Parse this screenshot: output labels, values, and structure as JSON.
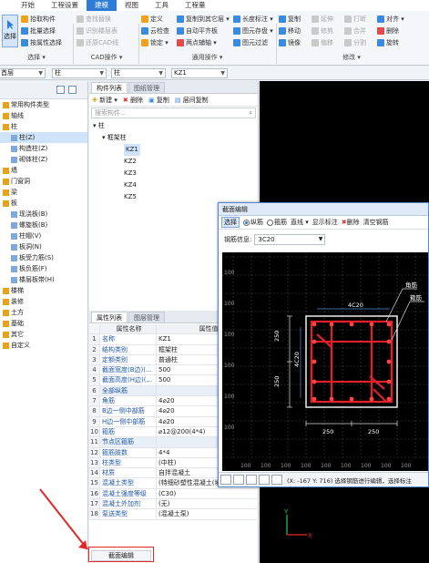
{
  "menubar": {
    "tabs": [
      "开始",
      "工程设置",
      "建模",
      "视图",
      "工具",
      "工程量"
    ],
    "active": 2
  },
  "ribbon": {
    "select_btn": "选择",
    "select_group": {
      "items": [
        "拾取构件",
        "批量选择",
        "按属性选择"
      ],
      "label": "选择 ▾"
    },
    "cad_group": {
      "items": [
        "查找替换",
        "识别楼层表",
        "还原CAD线"
      ],
      "label": "CAD操作 ▾"
    },
    "common_group": {
      "col1": [
        "定义",
        "云检查",
        "锁定 ▾"
      ],
      "col2": [
        "复制到其它层 ▾",
        "自动平齐板",
        "两点辅轴 ▾"
      ],
      "col3": [
        "长度标注 ▾",
        "图元存盘 ▾",
        "图元过滤"
      ],
      "label": "通用操作 ▾"
    },
    "modify_group": {
      "col1": [
        "复制",
        "移动",
        "镜像"
      ],
      "col2": [
        "延伸",
        "修剪",
        "偏移"
      ],
      "col3": [
        "打断",
        "合并",
        "分割"
      ],
      "col4": [
        "对齐 ▾",
        "删除",
        "旋转"
      ],
      "label": "修改 ▾"
    }
  },
  "combos": {
    "floor": "首层",
    "category": "柱",
    "subcategory": "柱",
    "element": "KZ1"
  },
  "left_tree": {
    "items": [
      {
        "label": "常用构件类型",
        "level": 0,
        "sel": false
      },
      {
        "label": "轴线",
        "level": 0
      },
      {
        "label": "柱",
        "level": 0
      },
      {
        "label": "柱(Z)",
        "level": 1,
        "sel": true
      },
      {
        "label": "构造柱(Z)",
        "level": 1
      },
      {
        "label": "砌体柱(Z)",
        "level": 1
      },
      {
        "label": "墙",
        "level": 0
      },
      {
        "label": "门窗洞",
        "level": 0
      },
      {
        "label": "梁",
        "level": 0
      },
      {
        "label": "板",
        "level": 0
      },
      {
        "label": "现浇板(B)",
        "level": 1
      },
      {
        "label": "螺旋板(B)",
        "level": 1
      },
      {
        "label": "柱帽(V)",
        "level": 1
      },
      {
        "label": "板洞(N)",
        "level": 1
      },
      {
        "label": "板受力筋(S)",
        "level": 1
      },
      {
        "label": "板负筋(F)",
        "level": 1
      },
      {
        "label": "楼层板带(H)",
        "level": 1
      },
      {
        "label": "楼梯",
        "level": 0
      },
      {
        "label": "装修",
        "level": 0
      },
      {
        "label": "土方",
        "level": 0
      },
      {
        "label": "基础",
        "level": 0
      },
      {
        "label": "其它",
        "level": 0
      },
      {
        "label": "自定义",
        "level": 0
      }
    ]
  },
  "component_list": {
    "tabs": [
      "构件列表",
      "图纸管理"
    ],
    "toolbar": [
      "新建 ▾",
      "删除",
      "复制",
      "层间复制"
    ],
    "search_placeholder": "搜索构件...",
    "tree": {
      "root": "柱",
      "group": "框架柱",
      "items": [
        "KZ1",
        "KZ2",
        "KZ3",
        "KZ4",
        "KZ5"
      ],
      "selected": "KZ1"
    }
  },
  "properties": {
    "tabs": [
      "属性列表",
      "图层管理"
    ],
    "header": [
      "属性名称",
      "属性值"
    ],
    "rows": [
      {
        "n": "1",
        "name": "名称",
        "value": "KZ1"
      },
      {
        "n": "2",
        "name": "结构类别",
        "value": "框架柱"
      },
      {
        "n": "3",
        "name": "定额类别",
        "value": "普通柱"
      },
      {
        "n": "4",
        "name": "截面宽度(B边)(...",
        "value": "500"
      },
      {
        "n": "5",
        "name": "截面高度(H边)(...",
        "value": "500"
      },
      {
        "n": "6",
        "name": "全部纵筋",
        "value": ""
      },
      {
        "n": "7",
        "name": "角筋",
        "value": "4⌀20"
      },
      {
        "n": "8",
        "name": "B边一侧中部筋",
        "value": "4⌀20"
      },
      {
        "n": "9",
        "name": "H边一侧中部筋",
        "value": "4⌀20"
      },
      {
        "n": "10",
        "name": "箍筋",
        "value": "⌀12@200(4*4)"
      },
      {
        "n": "11",
        "name": "节点区箍筋",
        "value": ""
      },
      {
        "n": "12",
        "name": "箍筋肢数",
        "value": "4*4"
      },
      {
        "n": "13",
        "name": "柱类型",
        "value": "(中柱)"
      },
      {
        "n": "14",
        "name": "材质",
        "value": "自拌混凝土"
      },
      {
        "n": "15",
        "name": "混凝土类型",
        "value": "(特细砂塑性混凝土(坍..."
      },
      {
        "n": "16",
        "name": "混凝土强度等级",
        "value": "(C30)"
      },
      {
        "n": "17",
        "name": "混凝土外加剂",
        "value": "(无)"
      },
      {
        "n": "18",
        "name": "泵送类型",
        "value": "(混凝土泵)"
      }
    ]
  },
  "dialog": {
    "title": "截面编辑",
    "tools": {
      "select": "选择",
      "longitudinal": "纵筋",
      "stirrup": "箍筋",
      "line": "直线 ▾",
      "show_label": "显示标注",
      "delete": "删除",
      "clear": "清空钢筋"
    },
    "rebar_info_label": "钢筋信息:",
    "rebar_info_value": "3C20",
    "drawing": {
      "top_label": "4C20",
      "side_label": "4C20",
      "dim1": "250",
      "dim2": "250",
      "dimv1": "250",
      "dimv2": "250",
      "callout1": "角筋",
      "callout2": "箍筋",
      "grid_labels": [
        "100",
        "100",
        "100",
        "100",
        "100",
        "100",
        "100",
        "100",
        "100"
      ]
    },
    "status": "(X: -167 Y: 716)  选择钢筋进行编辑，选择标注"
  },
  "bottom_tab": "截面编辑",
  "colors": {
    "accent": "#2d7bd6",
    "highlight": "#e32626",
    "rebar": "#e3202a"
  }
}
